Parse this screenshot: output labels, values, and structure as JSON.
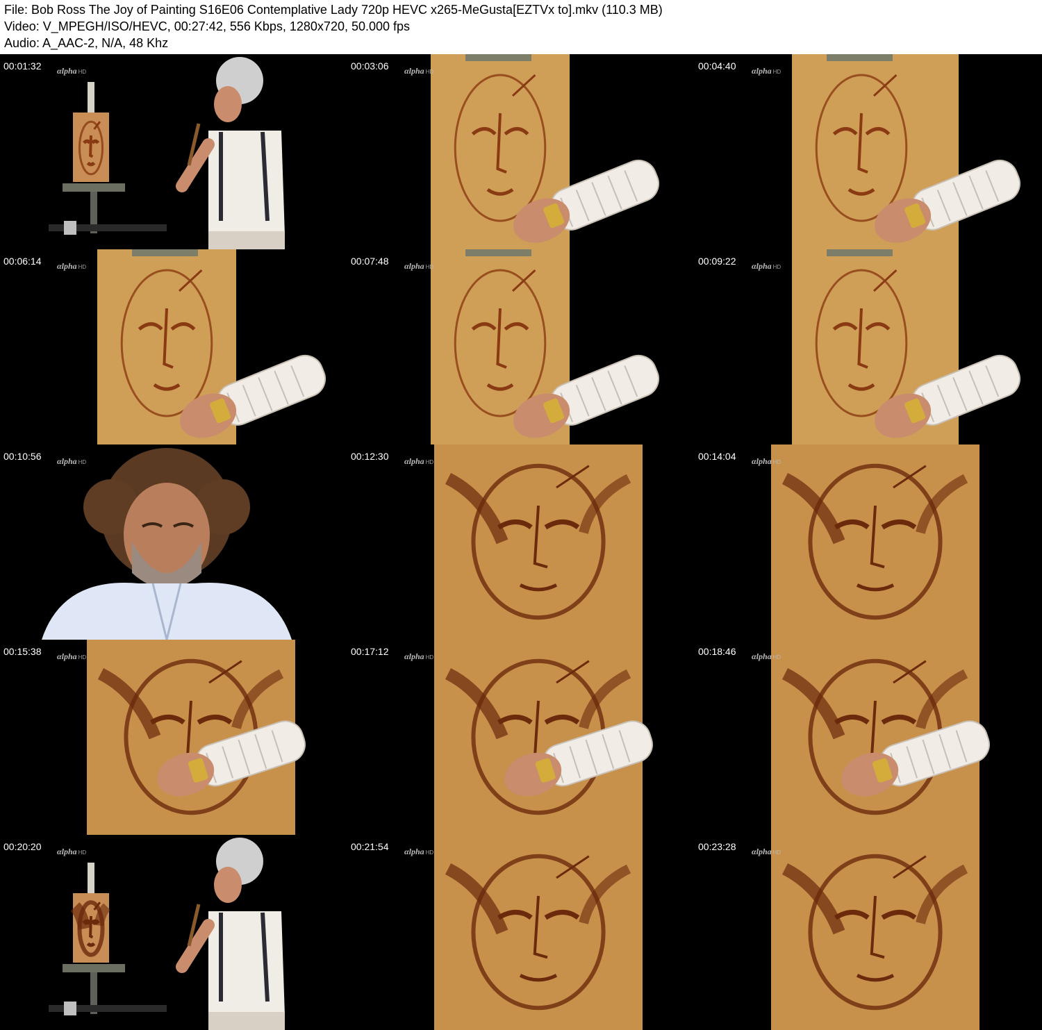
{
  "header": {
    "file_line": "File: Bob Ross The Joy of Painting S16E06 Contemplative Lady 720p HEVC x265-MeGusta[EZTVx to].mkv (110.3 MB)",
    "video_line": "Video: V_MPEGH/ISO/HEVC, 00:27:42, 556 Kbps, 1280x720, 50.000 fps",
    "audio_line": "Audio: A_AAC-2, N/A, 48 Khz"
  },
  "watermark": {
    "brand": "αlpha",
    "suffix": "HD"
  },
  "frames": [
    {
      "time": "00:01:32",
      "scene": "studio-wide"
    },
    {
      "time": "00:03:06",
      "scene": "sketch-closeup"
    },
    {
      "time": "00:04:40",
      "scene": "sketch-closeup"
    },
    {
      "time": "00:06:14",
      "scene": "sketch-closeup"
    },
    {
      "time": "00:07:48",
      "scene": "sketch-closeup"
    },
    {
      "time": "00:09:22",
      "scene": "sketch-closeup"
    },
    {
      "time": "00:10:56",
      "scene": "host-portrait"
    },
    {
      "time": "00:12:30",
      "scene": "painting-closeup"
    },
    {
      "time": "00:14:04",
      "scene": "painting-closeup"
    },
    {
      "time": "00:15:38",
      "scene": "painting-closeup"
    },
    {
      "time": "00:17:12",
      "scene": "painting-closeup"
    },
    {
      "time": "00:18:46",
      "scene": "painting-closeup"
    },
    {
      "time": "00:20:20",
      "scene": "studio-wide"
    },
    {
      "time": "00:21:54",
      "scene": "painting-closeup"
    },
    {
      "time": "00:23:28",
      "scene": "painting-closeup"
    }
  ]
}
